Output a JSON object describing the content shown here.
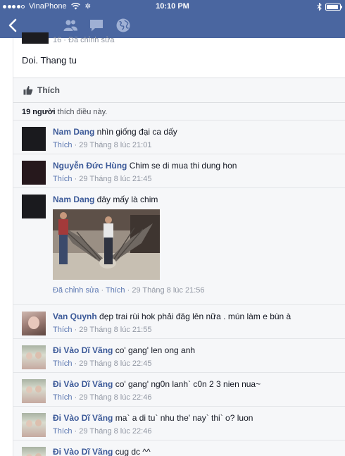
{
  "status_bar": {
    "carrier": "VinaPhone",
    "time": "10:10 PM",
    "battery_level": 0.9
  },
  "nav": {
    "icons": [
      "back-chevron-icon",
      "friends-icon",
      "messages-icon",
      "globe-icon"
    ]
  },
  "post": {
    "meta": "16 · Đã chỉnh sửa",
    "text": "Doi. Thang tu"
  },
  "actions": {
    "like_label": "Thích"
  },
  "likes": {
    "count": "19 người",
    "suffix": " thích điều này."
  },
  "comments": [
    {
      "name": "Nam Dang",
      "text": " nhìn giống đại ca dấy",
      "like": "Thích",
      "meta": " · 29 Tháng 8 lúc 21:01"
    },
    {
      "name": "Nguyễn Đức Hùng",
      "text": " Chim se di mua thi dung hon",
      "like": "Thích",
      "meta": " · 29 Tháng 8 lúc 21:45"
    },
    {
      "name": "Nam Dang",
      "text": " đây mấy là chim",
      "edited": "Đã chỉnh sửa",
      "like": "Thích",
      "meta": " · 29 Tháng 8 lúc 21:56"
    },
    {
      "name": "Van Quynh",
      "text": " đẹp trai rùi hok phải đăg lên nữa . mún làm e bùn à",
      "like": "Thích",
      "meta": " · 29 Tháng 8 lúc 21:55"
    },
    {
      "name": "Đi Vào Dĩ Vãng",
      "text": " co' gang' len ong anh",
      "like": "Thích",
      "meta": " · 29 Tháng 8 lúc 22:45"
    },
    {
      "name": "Đi Vào Dĩ Vãng",
      "text": " co' gang' ng0n lanh` c0n 2 3 nien nua~",
      "like": "Thích",
      "meta": " · 29 Tháng 8 lúc 22:46"
    },
    {
      "name": "Đi Vào Dĩ Vãng",
      "text": " ma` a di tu` nhu the' nay` thi` o? luon",
      "like": "Thích",
      "meta": " · 29 Tháng 8 lúc 22:46"
    },
    {
      "name": "Đi Vào Dĩ Vãng",
      "text": " cug dc ^^"
    }
  ],
  "colors": {
    "header_blue": "#4a66a0",
    "name_blue": "#3b5998",
    "link_blue": "#5b77b1",
    "meta_gray": "#9197a3",
    "panel_bg": "#f6f7f9"
  }
}
